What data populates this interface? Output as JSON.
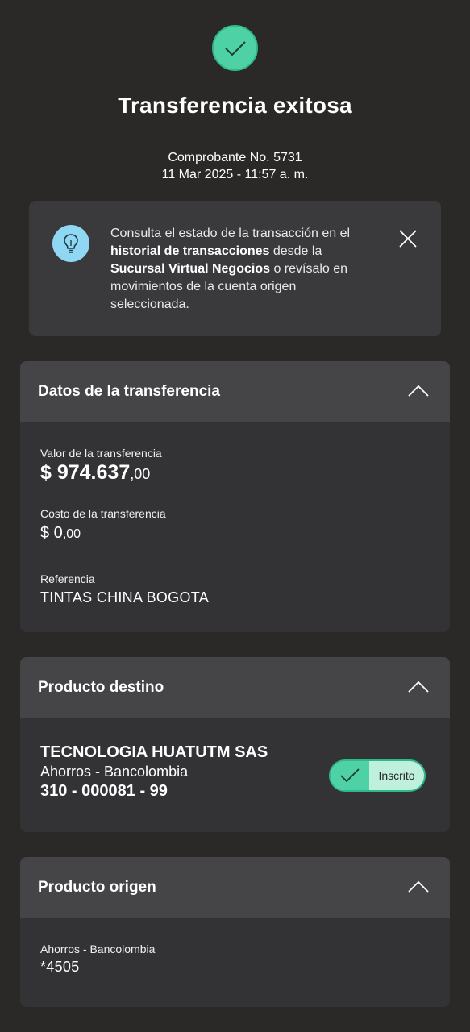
{
  "header": {
    "title": "Transferencia exitosa",
    "receipt_line": "Comprobante No. 5731",
    "date_line": "11 Mar 2025 - 11:57 a. m."
  },
  "info": {
    "text_1": "Consulta el estado de la transacción en el ",
    "bold_1": "historial de transacciones",
    "text_2": " desde la ",
    "bold_2": "Sucursal Virtual Negocios",
    "text_3": " o revísalo en movimientos de la cuenta origen seleccionada."
  },
  "transfer": {
    "title": "Datos de la transferencia",
    "value_label": "Valor de la transferencia",
    "value_int": "$ 974.637",
    "value_dec": ",00",
    "cost_label": "Costo de la transferencia",
    "cost_int": "$ 0",
    "cost_dec": ",00",
    "ref_label": "Referencia",
    "ref_value": "TINTAS CHINA BOGOTA"
  },
  "destination": {
    "title": "Producto destino",
    "name": "TECNOLOGIA HUATUTM SAS",
    "type": "Ahorros - Bancolombia",
    "account": "310 - 000081 - 99",
    "badge": "Inscrito"
  },
  "origin": {
    "title": "Producto origen",
    "type": "Ahorros - Bancolombia",
    "account": "*4505"
  },
  "colors": {
    "background": "#2a2928",
    "accent": "#4fd1a6",
    "info_icon": "#8fd7f2"
  },
  "icons": {
    "success": "check-circle-icon",
    "info": "lightbulb-icon",
    "close": "close-icon",
    "collapse": "chevron-up-icon",
    "badge": "check-icon"
  }
}
